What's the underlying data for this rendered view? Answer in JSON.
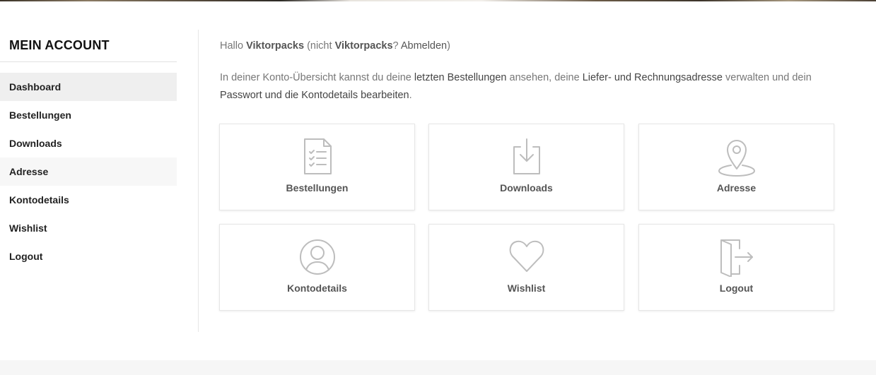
{
  "sidebar": {
    "title": "MEIN ACCOUNT",
    "items": [
      {
        "label": "Dashboard"
      },
      {
        "label": "Bestellungen"
      },
      {
        "label": "Downloads"
      },
      {
        "label": "Adresse"
      },
      {
        "label": "Kontodetails"
      },
      {
        "label": "Wishlist"
      },
      {
        "label": "Logout"
      }
    ],
    "active": "Dashboard"
  },
  "greeting": {
    "hello": "Hallo",
    "username": "Viktorpacks",
    "not_prefix": "(nicht",
    "username_again": "Viktorpacks",
    "question": "?",
    "logout_link": "Abmelden",
    "close_paren": ")"
  },
  "intro": {
    "part1": "In deiner Konto-Übersicht kannst du deine",
    "link_orders": "letzten Bestellungen",
    "part2": "ansehen, deine",
    "link_address": "Liefer- und Rechnungsadresse",
    "part3": "verwalten und dein",
    "link_account": "Passwort und die Kontodetails bearbeiten",
    "part4": "."
  },
  "tiles": [
    {
      "label": "Bestellungen",
      "icon": "document-checklist-icon"
    },
    {
      "label": "Downloads",
      "icon": "download-tray-icon"
    },
    {
      "label": "Adresse",
      "icon": "map-pin-icon"
    },
    {
      "label": "Kontodetails",
      "icon": "user-circle-icon"
    },
    {
      "label": "Wishlist",
      "icon": "heart-icon"
    },
    {
      "label": "Logout",
      "icon": "door-exit-icon"
    }
  ],
  "colors": {
    "icon_stroke": "#bdbdbd",
    "active_bg": "#efefef",
    "text_muted": "#777777"
  }
}
